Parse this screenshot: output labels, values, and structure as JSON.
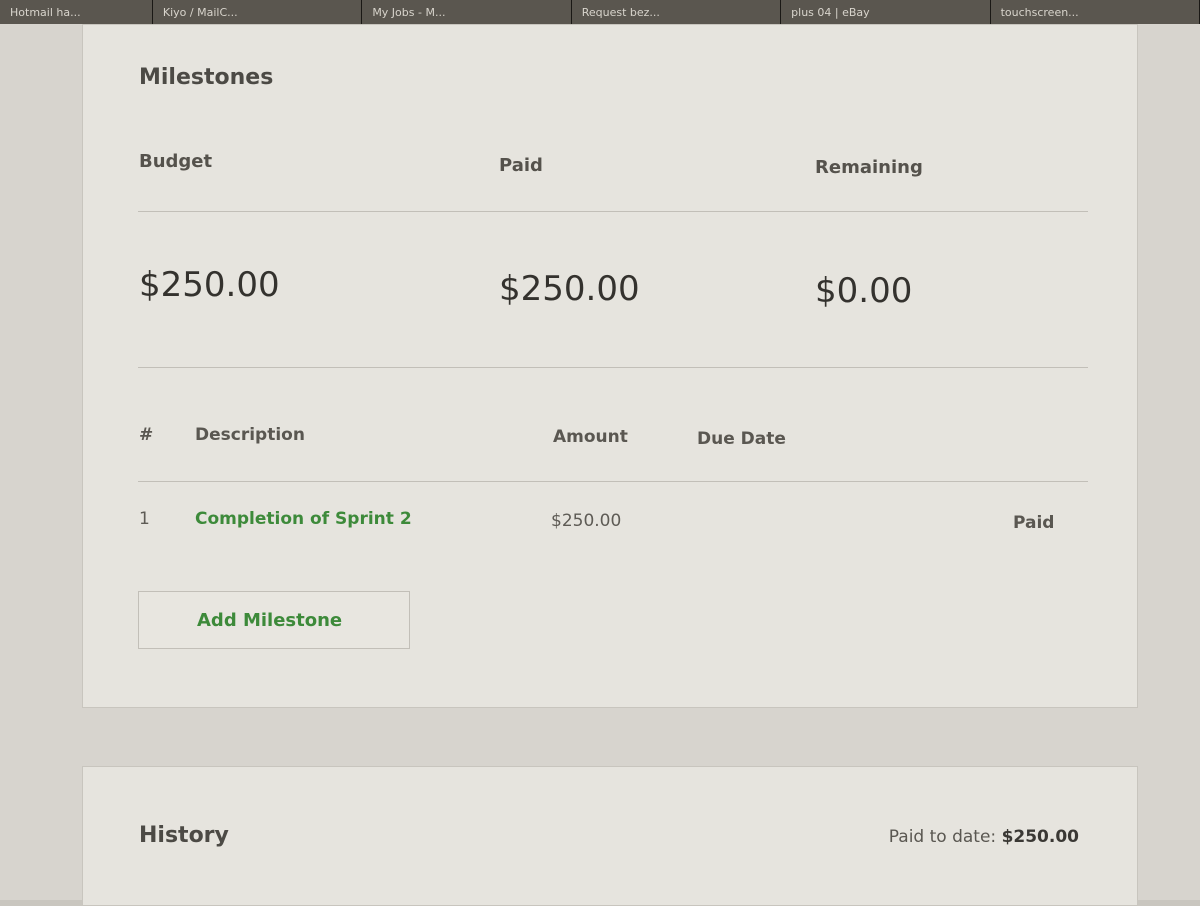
{
  "browser": {
    "tabs": [
      "Hotmail ha...",
      "Kiyo / MailC...",
      "My Jobs - M...",
      "Request bez...",
      "plus 04 | eBay",
      "touchscreen..."
    ]
  },
  "milestones": {
    "title": "Milestones",
    "summary": {
      "budget_label": "Budget",
      "paid_label": "Paid",
      "remaining_label": "Remaining",
      "budget_value": "$250.00",
      "paid_value": "$250.00",
      "remaining_value": "$0.00"
    },
    "table": {
      "columns": [
        "#",
        "Description",
        "Amount",
        "Due Date"
      ],
      "rows": [
        {
          "num": "1",
          "description": "Completion of Sprint 2",
          "amount": "$250.00",
          "due_date": "",
          "status": "Paid"
        }
      ]
    },
    "add_button_label": "Add Milestone"
  },
  "history": {
    "title": "History",
    "paid_to_date_label": "Paid to date:",
    "paid_to_date_value": "$250.00"
  },
  "colors": {
    "accent_green": "#3d8a3a",
    "card_bg": "#e6e4de",
    "text_dark": "#34322e"
  }
}
